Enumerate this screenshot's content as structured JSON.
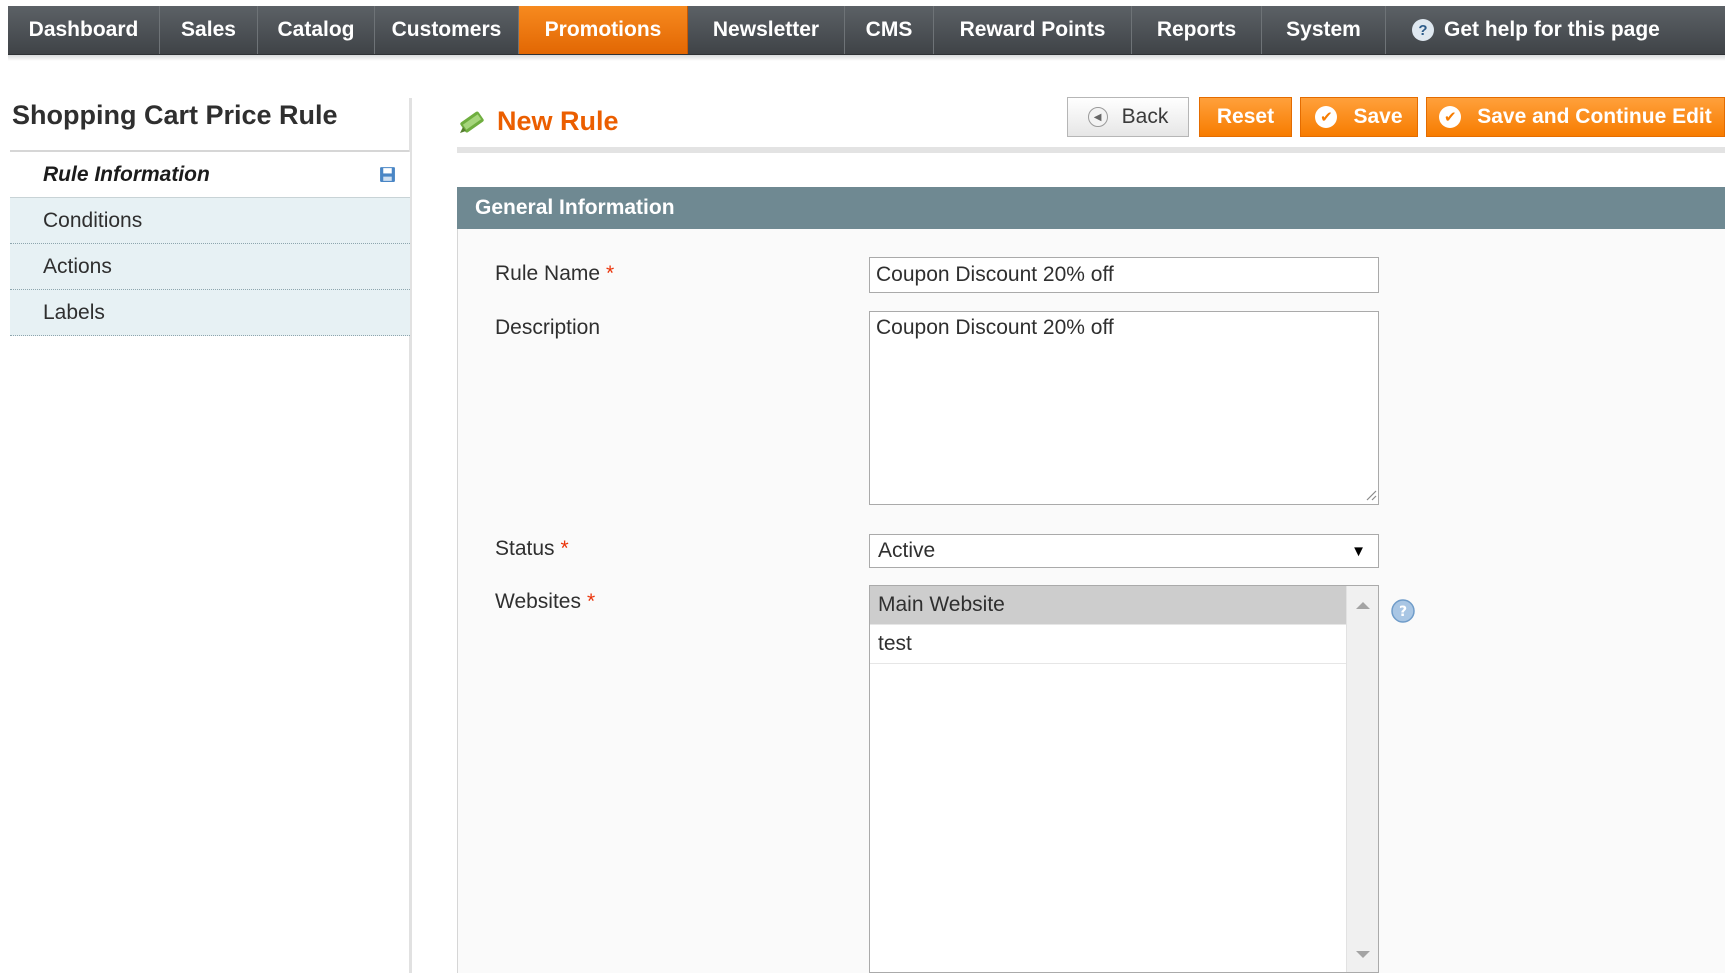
{
  "nav": {
    "items": [
      "Dashboard",
      "Sales",
      "Catalog",
      "Customers",
      "Promotions",
      "Newsletter",
      "CMS",
      "Reward Points",
      "Reports",
      "System"
    ],
    "active": "Promotions",
    "help_label": "Get help for this page",
    "help_glyph": "?"
  },
  "sidebar": {
    "title": "Shopping Cart Price Rule",
    "tabs": [
      "Rule Information",
      "Conditions",
      "Actions",
      "Labels"
    ]
  },
  "header": {
    "title": "New Rule",
    "buttons": {
      "back": "Back",
      "reset": "Reset",
      "save": "Save",
      "save_continue": "Save and Continue Edit"
    }
  },
  "section": {
    "title": "General Information",
    "fields": {
      "rule_name": {
        "label": "Rule Name",
        "required": "*",
        "value": "Coupon Discount 20% off"
      },
      "description": {
        "label": "Description",
        "value": "Coupon Discount 20% off"
      },
      "status": {
        "label": "Status",
        "required": "*",
        "value": "Active"
      },
      "websites": {
        "label": "Websites",
        "required": "*",
        "options": [
          "Main Website",
          "test"
        ],
        "selected": "Main Website"
      }
    }
  },
  "colors": {
    "nav_bg": "#4a4e52",
    "nav_active": "#f07b0c",
    "accent_title": "#eb5e00",
    "button_orange": "#f88c16",
    "section_header": "#6f8992",
    "tab_bg": "#e7f1f4",
    "required": "#eb340a"
  },
  "icons": {
    "page": "coupon-pencil-icon",
    "tab_save": "floppy-disk-icon",
    "help": "question-circle-icon",
    "back": "back-arrow-icon",
    "save": "checkmark-icon"
  }
}
